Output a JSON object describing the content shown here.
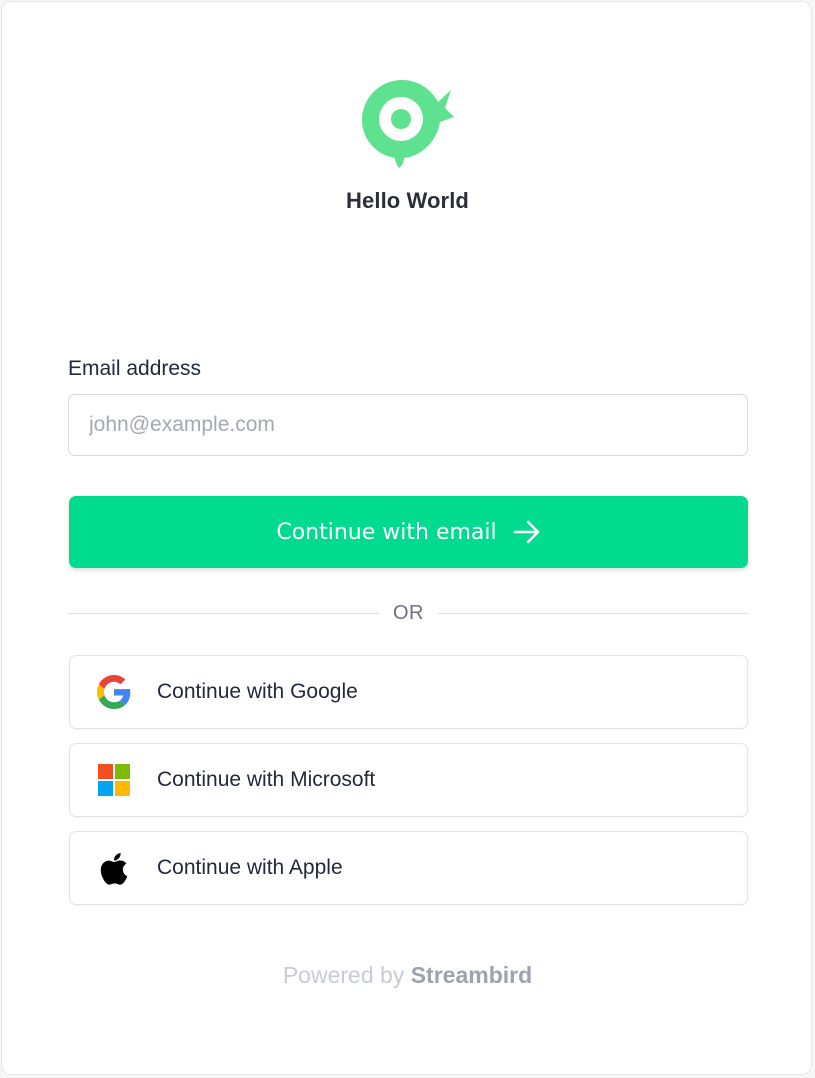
{
  "app": {
    "name": "Hello World",
    "logo_icon": "bird-logo-icon",
    "brand_color": "#5ee28f"
  },
  "form": {
    "email_label": "Email address",
    "email_value": "",
    "email_placeholder": "john@example.com",
    "submit_label": "Continue with email",
    "submit_icon": "arrow-right-icon",
    "submit_color": "#00db90"
  },
  "divider": {
    "text": "OR"
  },
  "social": [
    {
      "provider": "google",
      "label": "Continue with Google",
      "icon": "google-icon"
    },
    {
      "provider": "microsoft",
      "label": "Continue with Microsoft",
      "icon": "microsoft-icon"
    },
    {
      "provider": "apple",
      "label": "Continue with Apple",
      "icon": "apple-icon"
    }
  ],
  "footer": {
    "prefix": "Powered by",
    "brand": "Streambird"
  }
}
